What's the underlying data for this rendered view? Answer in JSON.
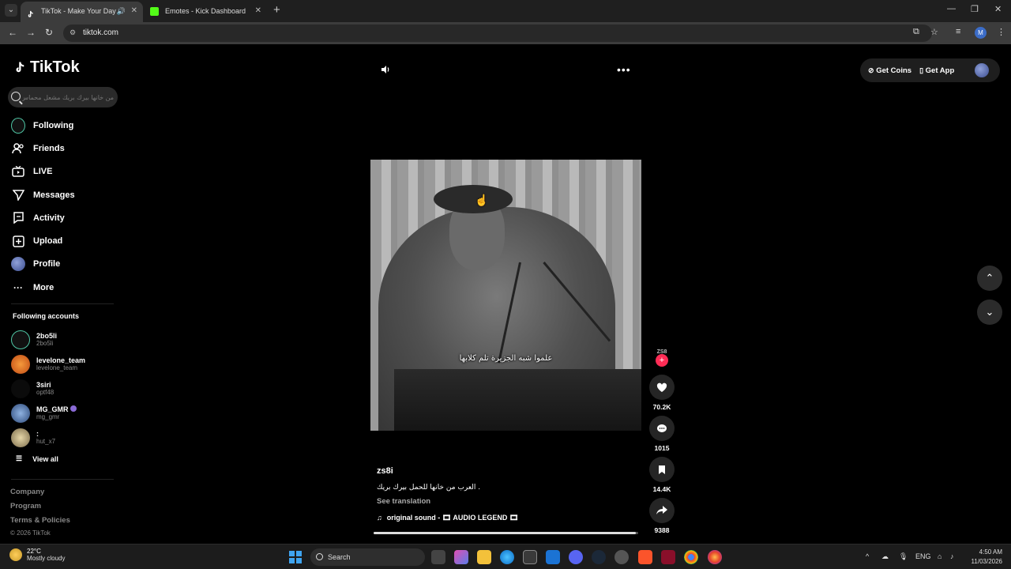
{
  "browser": {
    "tabs": [
      {
        "title": "TikTok - Make Your Day",
        "active": true
      },
      {
        "title": "Emotes - Kick Dashboard",
        "active": false
      }
    ],
    "url": "tiktok.com",
    "profile_initial": "M"
  },
  "tiktok": {
    "logo": "TikTok",
    "search_placeholder": "من خانها بيرك بريك مشعل محماس",
    "nav": [
      {
        "label": "Following",
        "icon": "following-avatar"
      },
      {
        "label": "Friends",
        "icon": "friends-icon"
      },
      {
        "label": "LIVE",
        "icon": "live-icon"
      },
      {
        "label": "Messages",
        "icon": "messages-icon"
      },
      {
        "label": "Activity",
        "icon": "activity-icon"
      },
      {
        "label": "Upload",
        "icon": "upload-icon"
      },
      {
        "label": "Profile",
        "icon": "profile-avatar"
      },
      {
        "label": "More",
        "icon": "more-icon"
      }
    ],
    "following_title": "Following accounts",
    "accounts": [
      {
        "name": "2bo5li",
        "handle": "2bo5li"
      },
      {
        "name": "levelone_team",
        "handle": "levelone_team"
      },
      {
        "name": "3siri",
        "handle": "optf48"
      },
      {
        "name": "MG_GMR",
        "handle": "mg_gmr"
      },
      {
        "name": ":",
        "handle": "hut_x7"
      }
    ],
    "view_all": "View all",
    "footer": [
      "Company",
      "Program",
      "Terms & Policies"
    ],
    "copyright": "© 2026 TikTok",
    "get_coins": "Get Coins",
    "get_app": "Get App"
  },
  "video": {
    "subtitle": "علموا شبه الجزيرة تلم كلابها",
    "creator_badge": "ZS8",
    "username": "zs8i",
    "caption": "العرب من خانها للحمل بيرك بريك .",
    "see_translation": "See translation",
    "sound": "original sound - 🎞 AUDIO LEGEND 🎞",
    "likes": "70.2K",
    "comments": "1015",
    "saves": "14.4K",
    "shares": "9388",
    "progress_fraction": 0.99
  },
  "taskbar": {
    "temperature": "22°C",
    "weather": "Mostly cloudy",
    "search": "Search",
    "language": "ENG",
    "time": "4:50 AM",
    "date": "11/03/2026"
  }
}
